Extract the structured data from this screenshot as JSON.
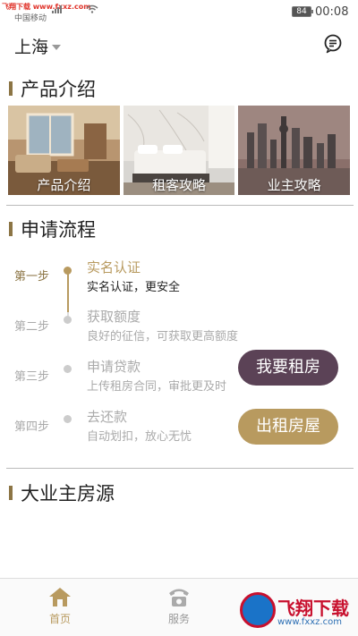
{
  "status_bar": {
    "watermark": "飞翔下载 www.fxxz.com",
    "carrier": "中国移动",
    "battery": "84",
    "time": "00:08"
  },
  "header": {
    "city": "上海",
    "icons": [
      "chevron-down-icon",
      "message-icon"
    ]
  },
  "product_section": {
    "title": "产品介绍",
    "items": [
      {
        "label": "产品介绍"
      },
      {
        "label": "租客攻略"
      },
      {
        "label": "业主攻略"
      }
    ]
  },
  "process_section": {
    "title": "申请流程",
    "steps": [
      {
        "label": "第一步",
        "title": "实名认证",
        "desc": "实名认证，更安全",
        "active": true
      },
      {
        "label": "第二步",
        "title": "获取额度",
        "desc": "良好的征信，可获取更高额度",
        "active": false
      },
      {
        "label": "第三步",
        "title": "申请贷款",
        "desc": "上传租房合同，审批更及时",
        "active": false
      },
      {
        "label": "第四步",
        "title": "去还款",
        "desc": "自动划扣，放心无忧",
        "active": false
      }
    ],
    "buttons": {
      "rent": "我要租房",
      "let": "出租房屋"
    }
  },
  "owner_section": {
    "title": "大业主房源"
  },
  "bottom_nav": {
    "items": [
      {
        "label": "首页",
        "icon": "home-icon",
        "active": true
      },
      {
        "label": "服务",
        "icon": "phone-icon",
        "active": false
      }
    ]
  },
  "watermark_logo": {
    "text": "飞翔下载",
    "url": "www.fxxz.com"
  },
  "colors": {
    "accent_gold": "#b89a5f",
    "accent_purple": "#5b4256",
    "section_bar": "#8c7545"
  }
}
